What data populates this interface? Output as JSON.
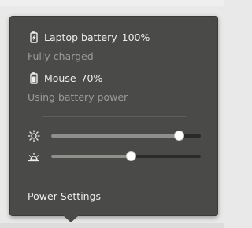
{
  "devices": [
    {
      "icon": "laptop-battery-charging-icon",
      "name": "Laptop battery",
      "percent": "100%",
      "status": "Fully charged"
    },
    {
      "icon": "mouse-battery-icon",
      "name": "Mouse",
      "percent": "70%",
      "status": "Using battery power"
    }
  ],
  "sliders": {
    "screen_brightness": {
      "icon": "brightness-icon",
      "level": 0.85
    },
    "keyboard_brightness": {
      "icon": "keyboard-brightness-icon",
      "level": 0.53
    }
  },
  "settings_link": "Power Settings",
  "colors": {
    "popover_bg": "#4a4a48",
    "text": "#eeeeec",
    "muted": "#9b9b98",
    "knob": "#ffffff"
  }
}
